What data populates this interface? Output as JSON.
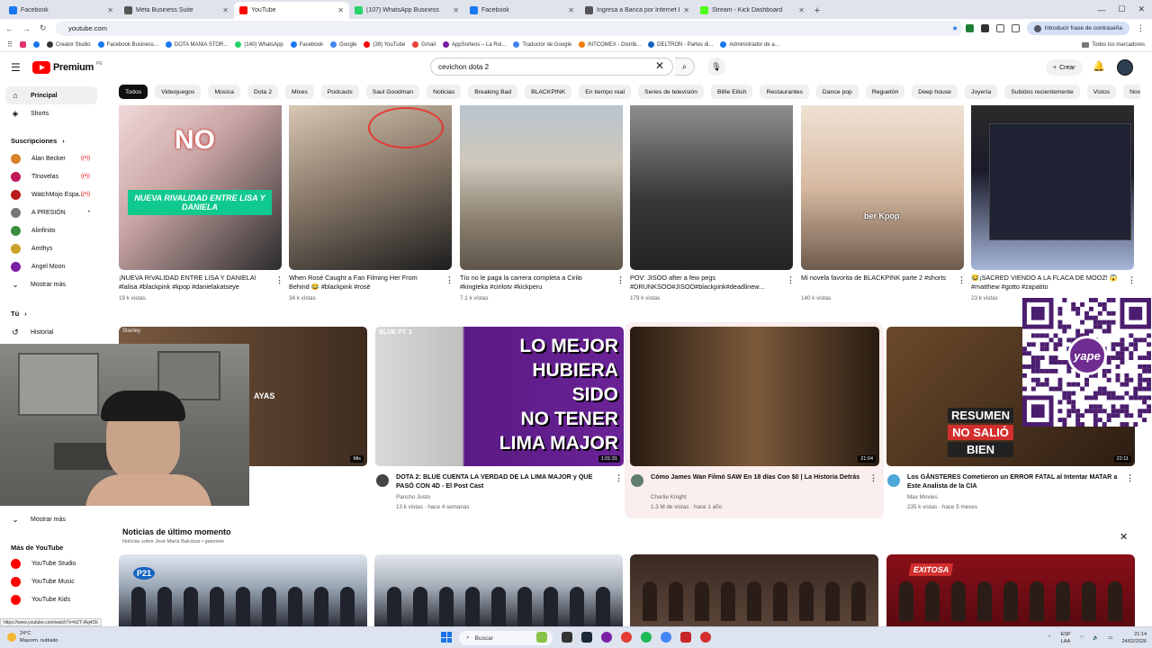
{
  "browser": {
    "tabs": [
      {
        "label": "Facebook",
        "color": "#1877f2",
        "active": false
      },
      {
        "label": "Meta Business Suite",
        "color": "#555555",
        "active": false
      },
      {
        "label": "YouTube",
        "color": "#ff0000",
        "active": true
      },
      {
        "label": "(107) WhatsApp Business",
        "color": "#25d366",
        "active": false
      },
      {
        "label": "Facebook",
        "color": "#1877f2",
        "active": false
      },
      {
        "label": "Ingresa a Banca por Internet BC",
        "color": "#555555",
        "active": false
      },
      {
        "label": "Stream - Kick Dashboard",
        "color": "#53fc18",
        "active": false
      }
    ],
    "url": "youtube.com",
    "password_pill": "Introducir frase de contraseña",
    "bookmarks": [
      "Creator Studio",
      "Facebook Business...",
      "DOTA MANIA STOR...",
      "(140) WhatsApp",
      "Facebook",
      "Google",
      "(39) YouTube",
      "Gmail",
      "AppSorteos – La Rul...",
      "Traductor de Google",
      "INTCOMEX - Distrib...",
      "DELTRON - Partes di...",
      "Administrador de a..."
    ],
    "bookmarks_folder": "Todos los marcadores"
  },
  "yt": {
    "logo": "Premium",
    "country": "PE",
    "search_value": "cevichon dota 2",
    "create_label": "Crear",
    "chips": [
      "Todos",
      "Videojuegos",
      "Música",
      "Dota 2",
      "Mixes",
      "Podcasts",
      "Saul Goodman",
      "Noticias",
      "Breaking Bad",
      "BLACKPINK",
      "En tiempo real",
      "Series de televisión",
      "Billie Eilish",
      "Restaurantes",
      "Dance pop",
      "Reguetón",
      "Deep house",
      "Joyería",
      "Subidos recientemente",
      "Vistos",
      "Novedad para ti"
    ]
  },
  "sidebar": {
    "principal": "Principal",
    "shorts": "Shorts",
    "subs_title": "Suscripciones",
    "subs": [
      {
        "name": "Alan Becker",
        "color": "#d9822b",
        "live": true
      },
      {
        "name": "Tlnovelas",
        "color": "#c2185b",
        "live": true
      },
      {
        "name": "WatchMojo Espa...",
        "color": "#b71c1c",
        "live": true
      },
      {
        "name": "A PRESIÓN",
        "color": "#777777",
        "live": false
      },
      {
        "name": "Alinfinito",
        "color": "#388e3c",
        "live": false
      },
      {
        "name": "Amthys",
        "color": "#c9a227",
        "live": false
      },
      {
        "name": "Angel Moon",
        "color": "#7b1fa2",
        "live": false
      }
    ],
    "mostrar_mas": "Mostrar más",
    "tu": "Tú",
    "historial": "Historial",
    "mostrar_mas_2": "Mostrar más",
    "more_title": "Más de YouTube",
    "more": [
      "YouTube Studio",
      "YouTube Music",
      "YouTube Kids"
    ]
  },
  "shorts": [
    {
      "title": "¡NUEVA RIVALIDAD ENTRE LISA Y DANIELA! #lalisa #blackpink #kpop #danielakatseye",
      "views": "19 k vistas",
      "overlay": "NUEVA RIVALIDAD ENTRE LISA Y DANIELA",
      "badge": "NO"
    },
    {
      "title": "When Rosé Caught a Fan Filming Her From Behind 😂 #blackpink #rosé",
      "views": "34 k vistas"
    },
    {
      "title": "Tío no le paga la carrera completa a Cirilo #kingteka #cirilotv #kickperu",
      "views": "7.1 k vistas"
    },
    {
      "title": "POV: JISOO after a few pegs #DRUNKSOO#JISOO#blackpink#deadlinew...",
      "views": "179 k vistas"
    },
    {
      "title": "Mi novela favorita de BLACKPINK parte 2 #shorts",
      "views": "140 k vistas",
      "overlay": "ber Kpop"
    },
    {
      "title": "😂¡SACRED VIENDO A LA FLACA DE MOOZ! 😱 #matthew #gotto #zapatito",
      "views": "23 k vistas"
    }
  ],
  "videos": [
    {
      "title": "",
      "channel": "",
      "meta": "",
      "overlay": "AYAS",
      "duration": "Mix",
      "topleft": "Stanley"
    },
    {
      "title": "DOTA 2: BLUE CUENTA LA VERDAD DE LA LIMA MAJOR y QUE PASÓ CON 4D - El Post Cast",
      "channel": "Pancho Justo",
      "meta": "13 k vistas · hace 4 semanas",
      "duration": "1:01:31",
      "lines": [
        "LO MEJOR",
        "HUBIERA",
        "SIDO",
        "NO TENER",
        "LIMA MAJOR"
      ],
      "tag": "BLUE PT. 2"
    },
    {
      "title": "Cómo James Wan Filmó SAW En 18 días Con $0 | La Historia Detrás",
      "channel": "Charlie Knight",
      "meta": "1.3 M de vistas · hace 1 año",
      "duration": "21:04"
    },
    {
      "title": "Los GÁNSTERES Cometieron un ERROR FATAL al Intentar MATAR a Este Analista de la CIA",
      "channel": "Max Movies",
      "meta": "235 k vistas · hace 5 meses",
      "duration": "22:11",
      "lines": [
        "RESUMEN",
        "NO SALIÓ",
        "BIEN"
      ]
    }
  ],
  "news": {
    "title": "Noticias de último momento",
    "subtitle": "Noticias sobre José María Balcázar • gatonete",
    "logos": [
      "P21",
      "",
      "",
      "EXITOSA"
    ]
  },
  "qr_brand": "yape",
  "status_link": "https://www.youtube.com/watch?v=bZT-iAg4Ok",
  "taskbar": {
    "temp": "24°C",
    "weather": "Mayorm. nublado",
    "search": "Buscar",
    "lang": "ESP",
    "lang2": "LAA",
    "time": "21:14",
    "date": "24/02/2026"
  }
}
